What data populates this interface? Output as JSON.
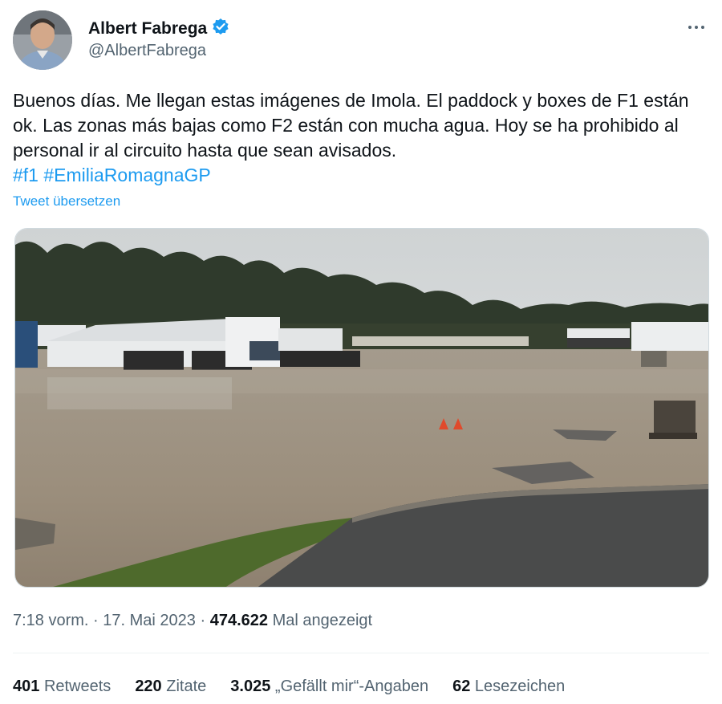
{
  "author": {
    "display_name": "Albert Fabrega",
    "handle": "@AlbertFabrega",
    "verified_icon": "verified-badge-icon",
    "avatar_icon": "profile-photo"
  },
  "more_icon": "more-options-icon",
  "tweet": {
    "text": "Buenos días.  Me llegan estas imágenes de Imola. El paddock y boxes de F1 están ok. Las zonas más bajas como F2 están con mucha agua. Hoy se ha prohibido al personal ir al circuito hasta que sean avisados.",
    "hashtag_1": "#f1",
    "hashtag_2": "#EmiliaRomagnaGP",
    "translate_label": "Tweet übersetzen"
  },
  "media": {
    "kind": "photo",
    "colors": {
      "sky": "#d9dcdc",
      "trees": "#2f3a2c",
      "water": "#9a8f7f",
      "asphalt": "#4a4b4b",
      "grass": "#4e6a2c"
    }
  },
  "meta": {
    "time": "7:18 vorm.",
    "separator": "·",
    "date": "17. Mai 2023",
    "views_count": "474.622",
    "views_label": "Mal angezeigt"
  },
  "stats": {
    "retweets_count": "401",
    "retweets_label": "Retweets",
    "quotes_count": "220",
    "quotes_label": "Zitate",
    "likes_count": "3.025",
    "likes_label": "„Gefällt mir“-Angaben",
    "bookmarks_count": "62",
    "bookmarks_label": "Lesezeichen"
  },
  "colors": {
    "accent": "#1d9bf0",
    "text": "#0f1419",
    "secondary": "#536471",
    "divider": "#eff3f4"
  }
}
